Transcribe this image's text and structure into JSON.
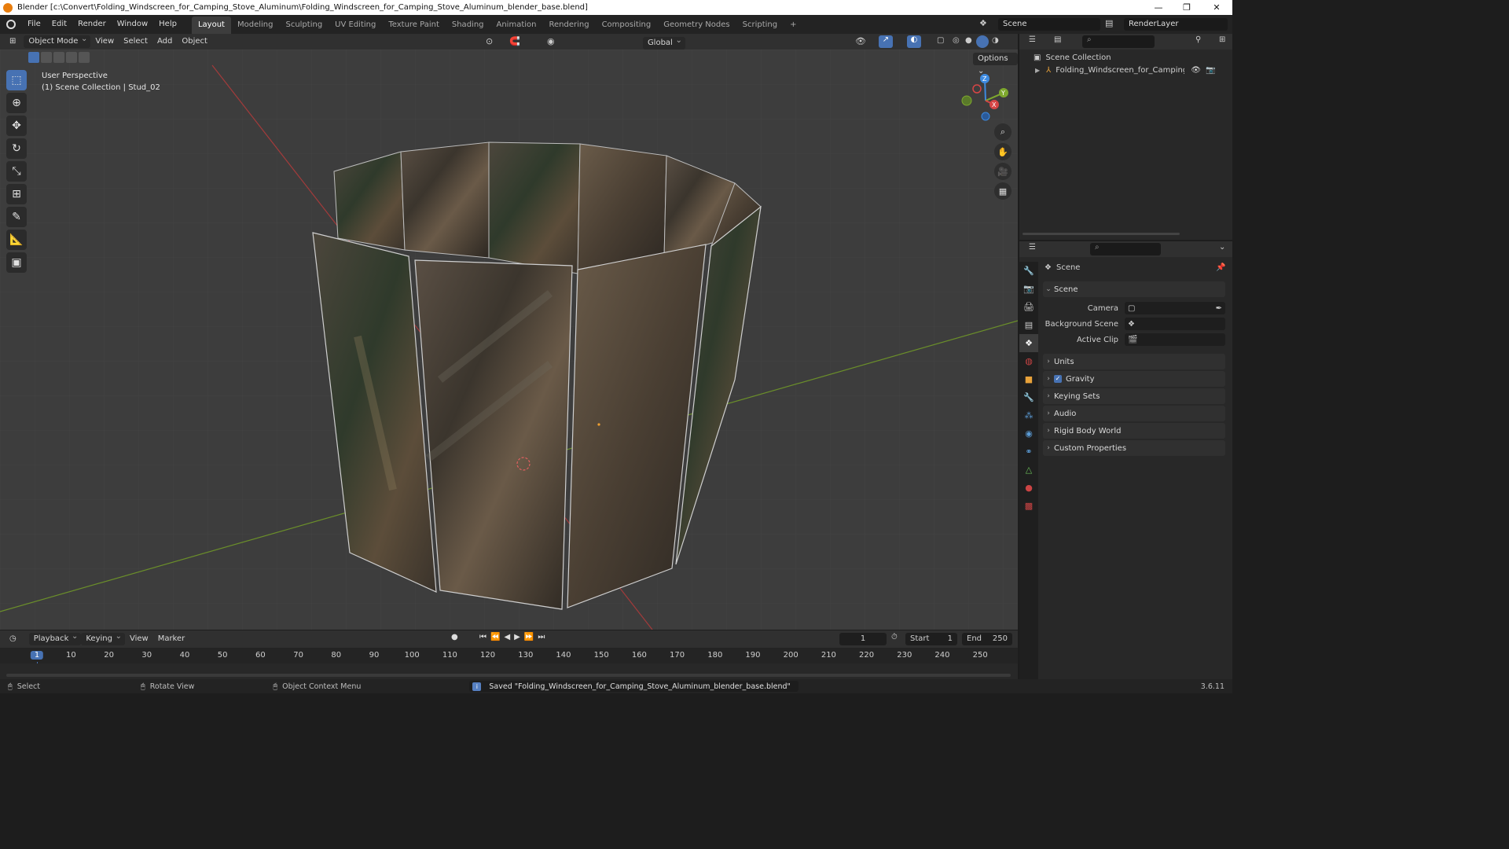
{
  "window": {
    "title": "Blender [c:\\Convert\\Folding_Windscreen_for_Camping_Stove_Aluminum\\Folding_Windscreen_for_Camping_Stove_Aluminum_blender_base.blend]"
  },
  "menu": [
    "File",
    "Edit",
    "Render",
    "Window",
    "Help"
  ],
  "workspaces": [
    {
      "label": "Layout",
      "active": true
    },
    {
      "label": "Modeling",
      "active": false
    },
    {
      "label": "Sculpting",
      "active": false
    },
    {
      "label": "UV Editing",
      "active": false
    },
    {
      "label": "Texture Paint",
      "active": false
    },
    {
      "label": "Shading",
      "active": false
    },
    {
      "label": "Animation",
      "active": false
    },
    {
      "label": "Rendering",
      "active": false
    },
    {
      "label": "Compositing",
      "active": false
    },
    {
      "label": "Geometry Nodes",
      "active": false
    },
    {
      "label": "Scripting",
      "active": false
    }
  ],
  "add_workspace": "+",
  "scene_selector": "Scene",
  "render_layer": "RenderLayer",
  "viewport": {
    "mode": "Object Mode",
    "menus": [
      "View",
      "Select",
      "Add",
      "Object"
    ],
    "orientation": "Global",
    "options_label": "Options",
    "overlay_line1": "User Perspective",
    "overlay_line2": "(1) Scene Collection | Stud_02",
    "gizmo_axes": {
      "z": "Z",
      "y": "Y",
      "x": "X"
    }
  },
  "outliner": {
    "root": "Scene Collection",
    "items": [
      "Folding_Windscreen_for_Camping_Stove"
    ]
  },
  "properties": {
    "context_label": "Scene",
    "panel_title": "Scene",
    "fields": [
      {
        "label": "Camera",
        "value": ""
      },
      {
        "label": "Background Scene",
        "value": ""
      },
      {
        "label": "Active Clip",
        "value": ""
      }
    ],
    "sections": [
      {
        "label": "Units",
        "checkbox": false
      },
      {
        "label": "Gravity",
        "checkbox": true
      },
      {
        "label": "Keying Sets",
        "checkbox": false
      },
      {
        "label": "Audio",
        "checkbox": false
      },
      {
        "label": "Rigid Body World",
        "checkbox": false
      },
      {
        "label": "Custom Properties",
        "checkbox": false
      }
    ]
  },
  "timeline": {
    "menus": [
      "Playback",
      "Keying",
      "View",
      "Marker"
    ],
    "current_frame": "1",
    "start_label": "Start",
    "start_value": "1",
    "end_label": "End",
    "end_value": "250",
    "ruler_labels": [
      "1",
      "10",
      "20",
      "30",
      "40",
      "50",
      "60",
      "70",
      "80",
      "90",
      "100",
      "110",
      "120",
      "130",
      "140",
      "150",
      "160",
      "170",
      "180",
      "190",
      "200",
      "210",
      "220",
      "230",
      "240",
      "250"
    ]
  },
  "statusbar": {
    "select": "Select",
    "rotate": "Rotate View",
    "context_menu": "Object Context Menu",
    "message": "Saved \"Folding_Windscreen_for_Camping_Stove_Aluminum_blender_base.blend\"",
    "version": "3.6.11"
  },
  "colors": {
    "accent": "#4772b3",
    "viewport_bg": "#3d3d3d",
    "panel_bg": "#282828",
    "header_bg": "#303030",
    "x_axis": "#d64545",
    "y_axis": "#7ea82e",
    "z_axis": "#3d8ae0",
    "playhead": "#4772b3"
  }
}
